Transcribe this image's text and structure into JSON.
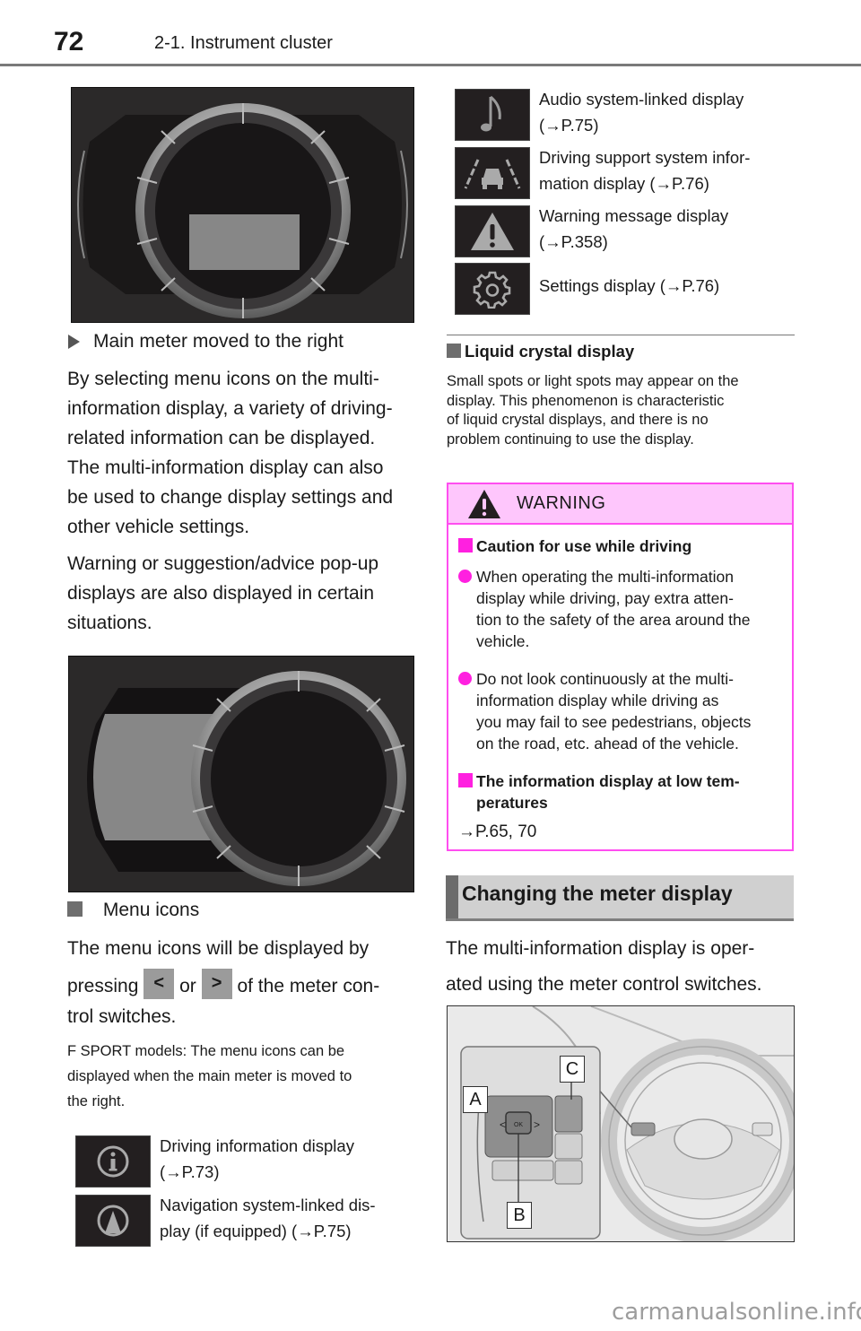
{
  "header": {
    "page_number": "72",
    "section": "2-1. Instrument cluster"
  },
  "left_column": {
    "image1_caption": "Main meter moved to the right",
    "paragraph1": [
      "By selecting menu icons on the multi-",
      "information display, a variety of driving-",
      "related information can be displayed.",
      "The multi-information display can also",
      "be used to change display settings and",
      "other vehicle settings."
    ],
    "paragraph2": [
      "Warning or suggestion/advice pop-up",
      "displays are also displayed in certain",
      "situations."
    ],
    "menu_icons": {
      "heading": "Menu icons",
      "line1": "The menu icons will be displayed by",
      "line2_pre": "pressing",
      "line2_or": "or",
      "line2_post": "of the meter con-",
      "line3": "trol switches.",
      "left_button": "<",
      "right_button": ">",
      "note": [
        "F SPORT models: The menu icons can be",
        "displayed when the main meter is moved to",
        "the right."
      ]
    },
    "icons": [
      {
        "icon": "info-circle-icon",
        "lines": [
          "Driving information display",
          "(→P.73)"
        ]
      },
      {
        "icon": "navigation-icon",
        "lines": [
          "Navigation system-linked dis-",
          "play (if equipped) (→P.75)"
        ]
      }
    ]
  },
  "right_column": {
    "icons": [
      {
        "icon": "music-note-icon",
        "lines": [
          "Audio system-linked display",
          "(→P.75)"
        ]
      },
      {
        "icon": "driving-support-icon",
        "lines": [
          "Driving support system infor-",
          "mation display (→P.76)"
        ]
      },
      {
        "icon": "warning-triangle-icon",
        "lines": [
          "Warning message display",
          "(→P.358)"
        ]
      },
      {
        "icon": "gear-icon",
        "lines": [
          "Settings display (→P.76)"
        ]
      }
    ],
    "lcd": {
      "heading": "Liquid crystal display",
      "text": [
        "Small spots or light spots may appear on the",
        "display. This phenomenon is characteristic",
        "of liquid crystal displays, and there is no",
        "problem continuing to use the display."
      ]
    },
    "warning": {
      "title": "WARNING",
      "sub1": "Caution for use while driving",
      "item1": [
        "When operating the multi-information",
        "display while driving, pay extra atten-",
        "tion to the safety of the area around the",
        "vehicle."
      ],
      "item2": [
        "Do not look continuously at the multi-",
        "information display while driving as",
        "you may fail to see pedestrians, objects",
        "on the road, etc. ahead of the vehicle."
      ],
      "sub2": [
        "The information display at low tem-",
        "peratures"
      ],
      "ref": "→P.65, 70"
    },
    "changing": {
      "heading": "Changing the meter display",
      "text": [
        "The multi-information display is oper-",
        "ated using the meter control switches."
      ],
      "labels": {
        "a": "A",
        "b": "B",
        "c": "C"
      }
    }
  },
  "colors": {
    "warning_accent": "#ff20e0",
    "warning_header_bg": "#fec6fc",
    "heading_bar_bg": "#d0d0d0"
  },
  "footer": {
    "watermark": "carmanualsonline.info"
  }
}
